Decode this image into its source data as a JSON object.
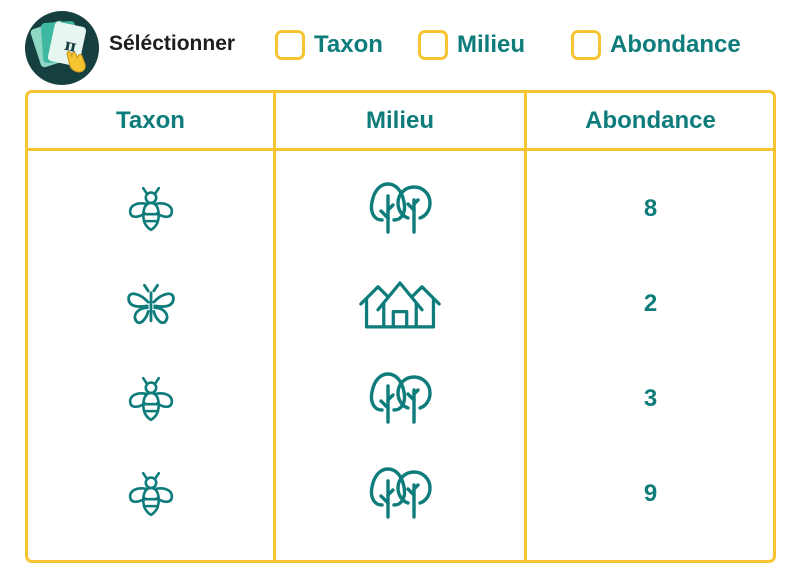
{
  "toolbar": {
    "logo_icon": "cards-pointer-icon",
    "select_label": "Séléctionner",
    "checkboxes": [
      {
        "label": "Taxon",
        "checked": false
      },
      {
        "label": "Milieu",
        "checked": false
      },
      {
        "label": "Abondance",
        "checked": false
      }
    ]
  },
  "table": {
    "headers": [
      "Taxon",
      "Milieu",
      "Abondance"
    ],
    "rows": [
      {
        "taxon_icon": "bee-icon",
        "milieu_icon": "trees-icon",
        "abondance": "8"
      },
      {
        "taxon_icon": "butterfly-icon",
        "milieu_icon": "houses-icon",
        "abondance": "2"
      },
      {
        "taxon_icon": "bee-icon",
        "milieu_icon": "trees-icon",
        "abondance": "3"
      },
      {
        "taxon_icon": "bee-icon",
        "milieu_icon": "trees-icon",
        "abondance": "9"
      }
    ]
  },
  "colors": {
    "accent": "#f6c431",
    "text": "#0e7c7b",
    "dark_text": "#1d1d1b"
  }
}
